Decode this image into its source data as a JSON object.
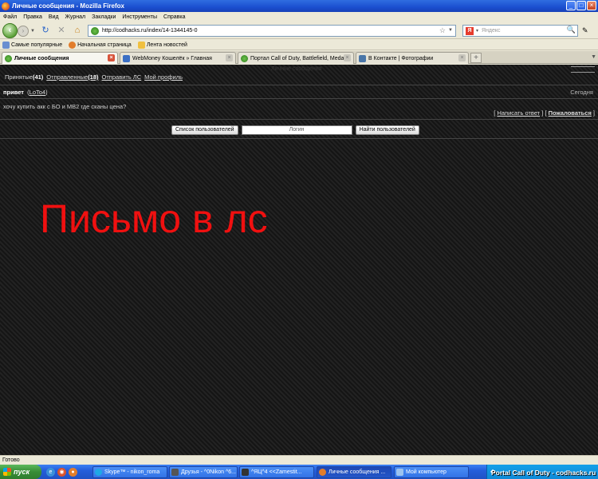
{
  "window": {
    "title": "Личные сообщения - Mozilla Firefox"
  },
  "menu": [
    "Файл",
    "Правка",
    "Вид",
    "Журнал",
    "Закладки",
    "Инструменты",
    "Справка"
  ],
  "nav": {
    "url": "http://codhacks.ru/index/14-1344145-0",
    "search_placeholder": "Яндекс",
    "search_engine_letter": "Я"
  },
  "bookmarks": [
    "Самые популярные",
    "Начальная страница",
    "Лента новостей"
  ],
  "tabs": [
    {
      "label": "Личные сообщения",
      "active": true
    },
    {
      "label": "WebMoney Кошелёк » Главная",
      "active": false
    },
    {
      "label": "Портал Call of Duty, Battlefield, Medal ...",
      "active": false
    },
    {
      "label": "В Контакте | Фотографии",
      "active": false
    }
  ],
  "pm": {
    "nav": {
      "inbox_label": "Принятые",
      "inbox_count": "(41)",
      "sent_label": "Отправленные",
      "sent_count": "(18)",
      "send_label": "Отправить ЛС",
      "profile_label": "Мой профиль"
    },
    "faint_header": "Личные сообщения",
    "message": {
      "subject": "привет",
      "author": "LoTo4",
      "date": "Сегодня",
      "body": "хочу купить акк с БО и MB2 где сканы цена?",
      "reply_label": "Написать ответ",
      "complain_label": "Пожаловаться"
    },
    "finder": {
      "list_button": "Список пользователей",
      "login_value": "Логин",
      "find_button": "Найти пользователей"
    }
  },
  "overlay_text": "Письмо в лс",
  "status": "Готово",
  "taskbar": {
    "start_label": "пуск",
    "tasks": [
      "Skype™ - nikon_roma",
      "Друзья - ^0Nikon ^6...",
      "^ЯЦ^4 <<Zamestit...",
      "Личные сообщения ...",
      "Мой компьютер"
    ]
  },
  "portal_text": "Portal Call of Duty - codhacks.ru"
}
